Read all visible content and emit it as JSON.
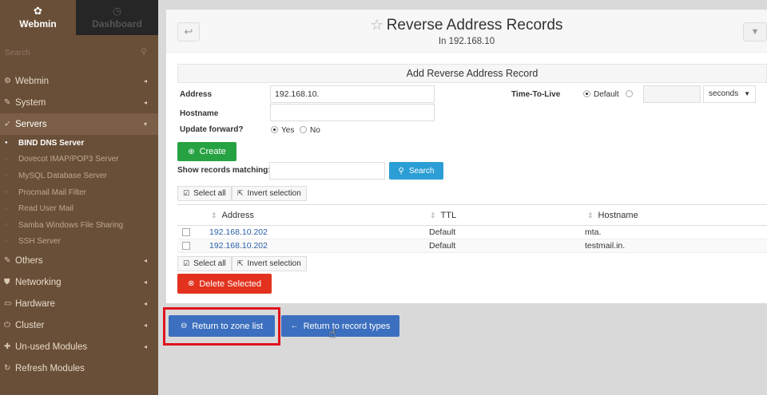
{
  "sidebar": {
    "tabs": [
      {
        "label": "Webmin",
        "icon": "webmin-logo-icon"
      },
      {
        "label": "Dashboard",
        "icon": "dashboard-icon"
      }
    ],
    "search_placeholder": "Search",
    "menu": [
      {
        "label": "Webmin",
        "icon": "gear-icon"
      },
      {
        "label": "System",
        "icon": "wrench-icon"
      },
      {
        "label": "Servers",
        "icon": "rocket-icon"
      },
      {
        "label": "Others",
        "icon": "wrench-icon"
      },
      {
        "label": "Networking",
        "icon": "shield-icon"
      },
      {
        "label": "Hardware",
        "icon": "hdd-icon"
      },
      {
        "label": "Cluster",
        "icon": "power-icon"
      },
      {
        "label": "Un-used Modules",
        "icon": "puzzle-icon"
      },
      {
        "label": "Refresh Modules",
        "icon": "refresh-icon"
      }
    ],
    "servers_sub": [
      "BIND DNS Server",
      "Dovecot IMAP/POP3 Server",
      "MySQL Database Server",
      "Procmail Mail Filter",
      "Read User Mail",
      "Samba Windows File Sharing",
      "SSH Server"
    ]
  },
  "header": {
    "title": "Reverse Address Records",
    "subtitle": "In 192.168.10"
  },
  "form": {
    "panel_title": "Add Reverse Address Record",
    "address_label": "Address",
    "address_value": "192.168.10.",
    "hostname_label": "Hostname",
    "hostname_value": "",
    "update_forward_label": "Update forward?",
    "yes_label": "Yes",
    "no_label": "No",
    "ttl_label": "Time-To-Live",
    "ttl_default_label": "Default",
    "ttl_value": "",
    "ttl_unit": "seconds",
    "create_label": "Create"
  },
  "search": {
    "label": "Show records matching:",
    "value": "",
    "button": "Search"
  },
  "bulk": {
    "select_all": "Select all",
    "invert": "Invert selection",
    "delete": "Delete Selected"
  },
  "table": {
    "headers": [
      "Address",
      "TTL",
      "Hostname"
    ],
    "rows": [
      {
        "address": "192.168.10.202",
        "ttl": "Default",
        "hostname": "mta."
      },
      {
        "address": "192.168.10.202",
        "ttl": "Default",
        "hostname": "testmail.in."
      }
    ]
  },
  "footer": {
    "return_zone": "Return to zone list",
    "return_types": "Return to record types"
  }
}
